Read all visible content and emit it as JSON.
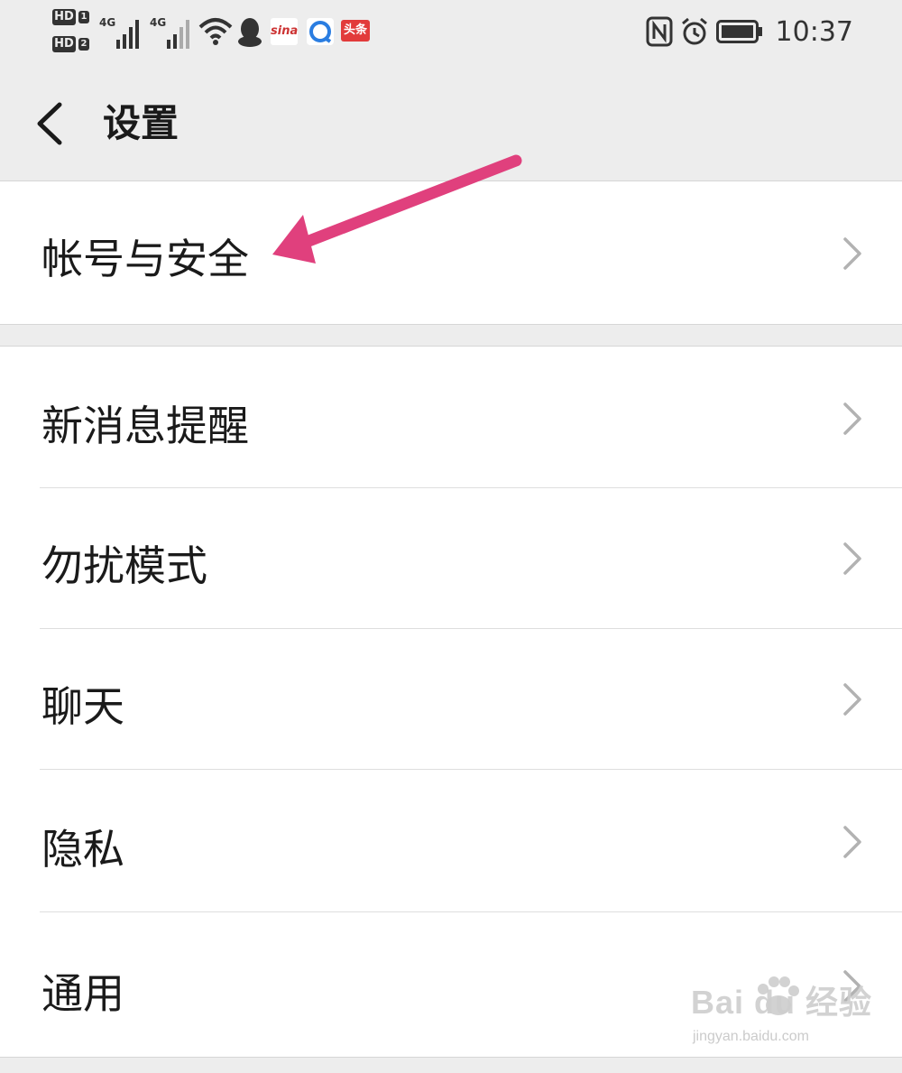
{
  "status_bar": {
    "hd1": "HD",
    "hd1_num": "1",
    "hd2": "HD",
    "hd2_num": "2",
    "net1": "4G",
    "net2": "4G",
    "sina_label": "sina",
    "toutiao_label": "头条",
    "time": "10:37"
  },
  "nav": {
    "title": "设置"
  },
  "groups": [
    {
      "items": [
        {
          "label": "帐号与安全"
        }
      ]
    },
    {
      "items": [
        {
          "label": "新消息提醒"
        },
        {
          "label": "勿扰模式"
        },
        {
          "label": "聊天"
        },
        {
          "label": "隐私"
        },
        {
          "label": "通用"
        }
      ]
    }
  ],
  "annotation": {
    "color": "#e0407d"
  },
  "watermark": {
    "text": "Bai du 经验",
    "url": "jingyan.baidu.com"
  },
  "colors": {
    "background": "#ededed",
    "card": "#ffffff",
    "text": "#1a1a1a",
    "chevron": "#b2b2b2"
  }
}
